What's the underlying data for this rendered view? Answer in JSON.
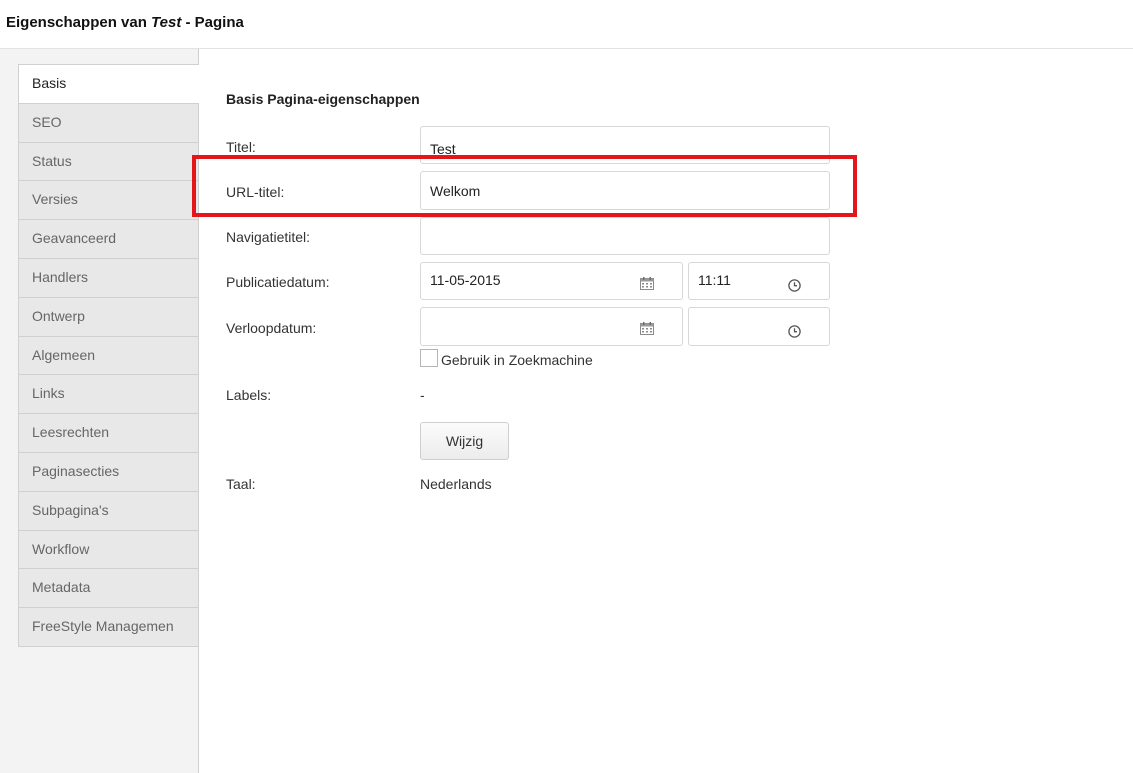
{
  "header": {
    "title_prefix": "Eigenschappen van ",
    "title_name": "Test",
    "title_suffix": " - Pagina"
  },
  "sidebar": {
    "tabs": [
      {
        "label": "Basis",
        "active": true
      },
      {
        "label": "SEO",
        "active": false
      },
      {
        "label": "Status",
        "active": false
      },
      {
        "label": "Versies",
        "active": false
      },
      {
        "label": "Geavanceerd",
        "active": false
      },
      {
        "label": "Handlers",
        "active": false
      },
      {
        "label": "Ontwerp",
        "active": false
      },
      {
        "label": "Algemeen",
        "active": false
      },
      {
        "label": "Links",
        "active": false
      },
      {
        "label": "Leesrechten",
        "active": false
      },
      {
        "label": "Paginasecties",
        "active": false
      },
      {
        "label": "Subpagina's",
        "active": false
      },
      {
        "label": "Workflow",
        "active": false
      },
      {
        "label": "Metadata",
        "active": false
      },
      {
        "label": "FreeStyle Managemen",
        "active": false
      }
    ]
  },
  "form": {
    "section_title": "Basis Pagina-eigenschappen",
    "title_label": "Titel:",
    "title_value": "Test",
    "url_title_label": "URL-titel:",
    "url_title_value": "Welkom",
    "nav_title_label": "Navigatietitel:",
    "nav_title_value": "",
    "publication_label": "Publicatiedatum:",
    "publication_date": "11-05-2015",
    "publication_time": "11:11",
    "expiry_label": "Verloopdatum:",
    "expiry_date": "",
    "expiry_time": "",
    "search_engine_label": "Gebruik in Zoekmachine",
    "search_engine_checked": false,
    "labels_label": "Labels:",
    "labels_value": "-",
    "change_button_label": "Wijzig",
    "language_label": "Taal:",
    "language_value": "Nederlands"
  },
  "colors": {
    "highlight": "#e3161b",
    "tab_inactive_bg": "#e8e8e8",
    "tab_active_bg": "#ffffff"
  },
  "icons": {
    "date": "calendar-icon",
    "time": "clock-icon"
  }
}
